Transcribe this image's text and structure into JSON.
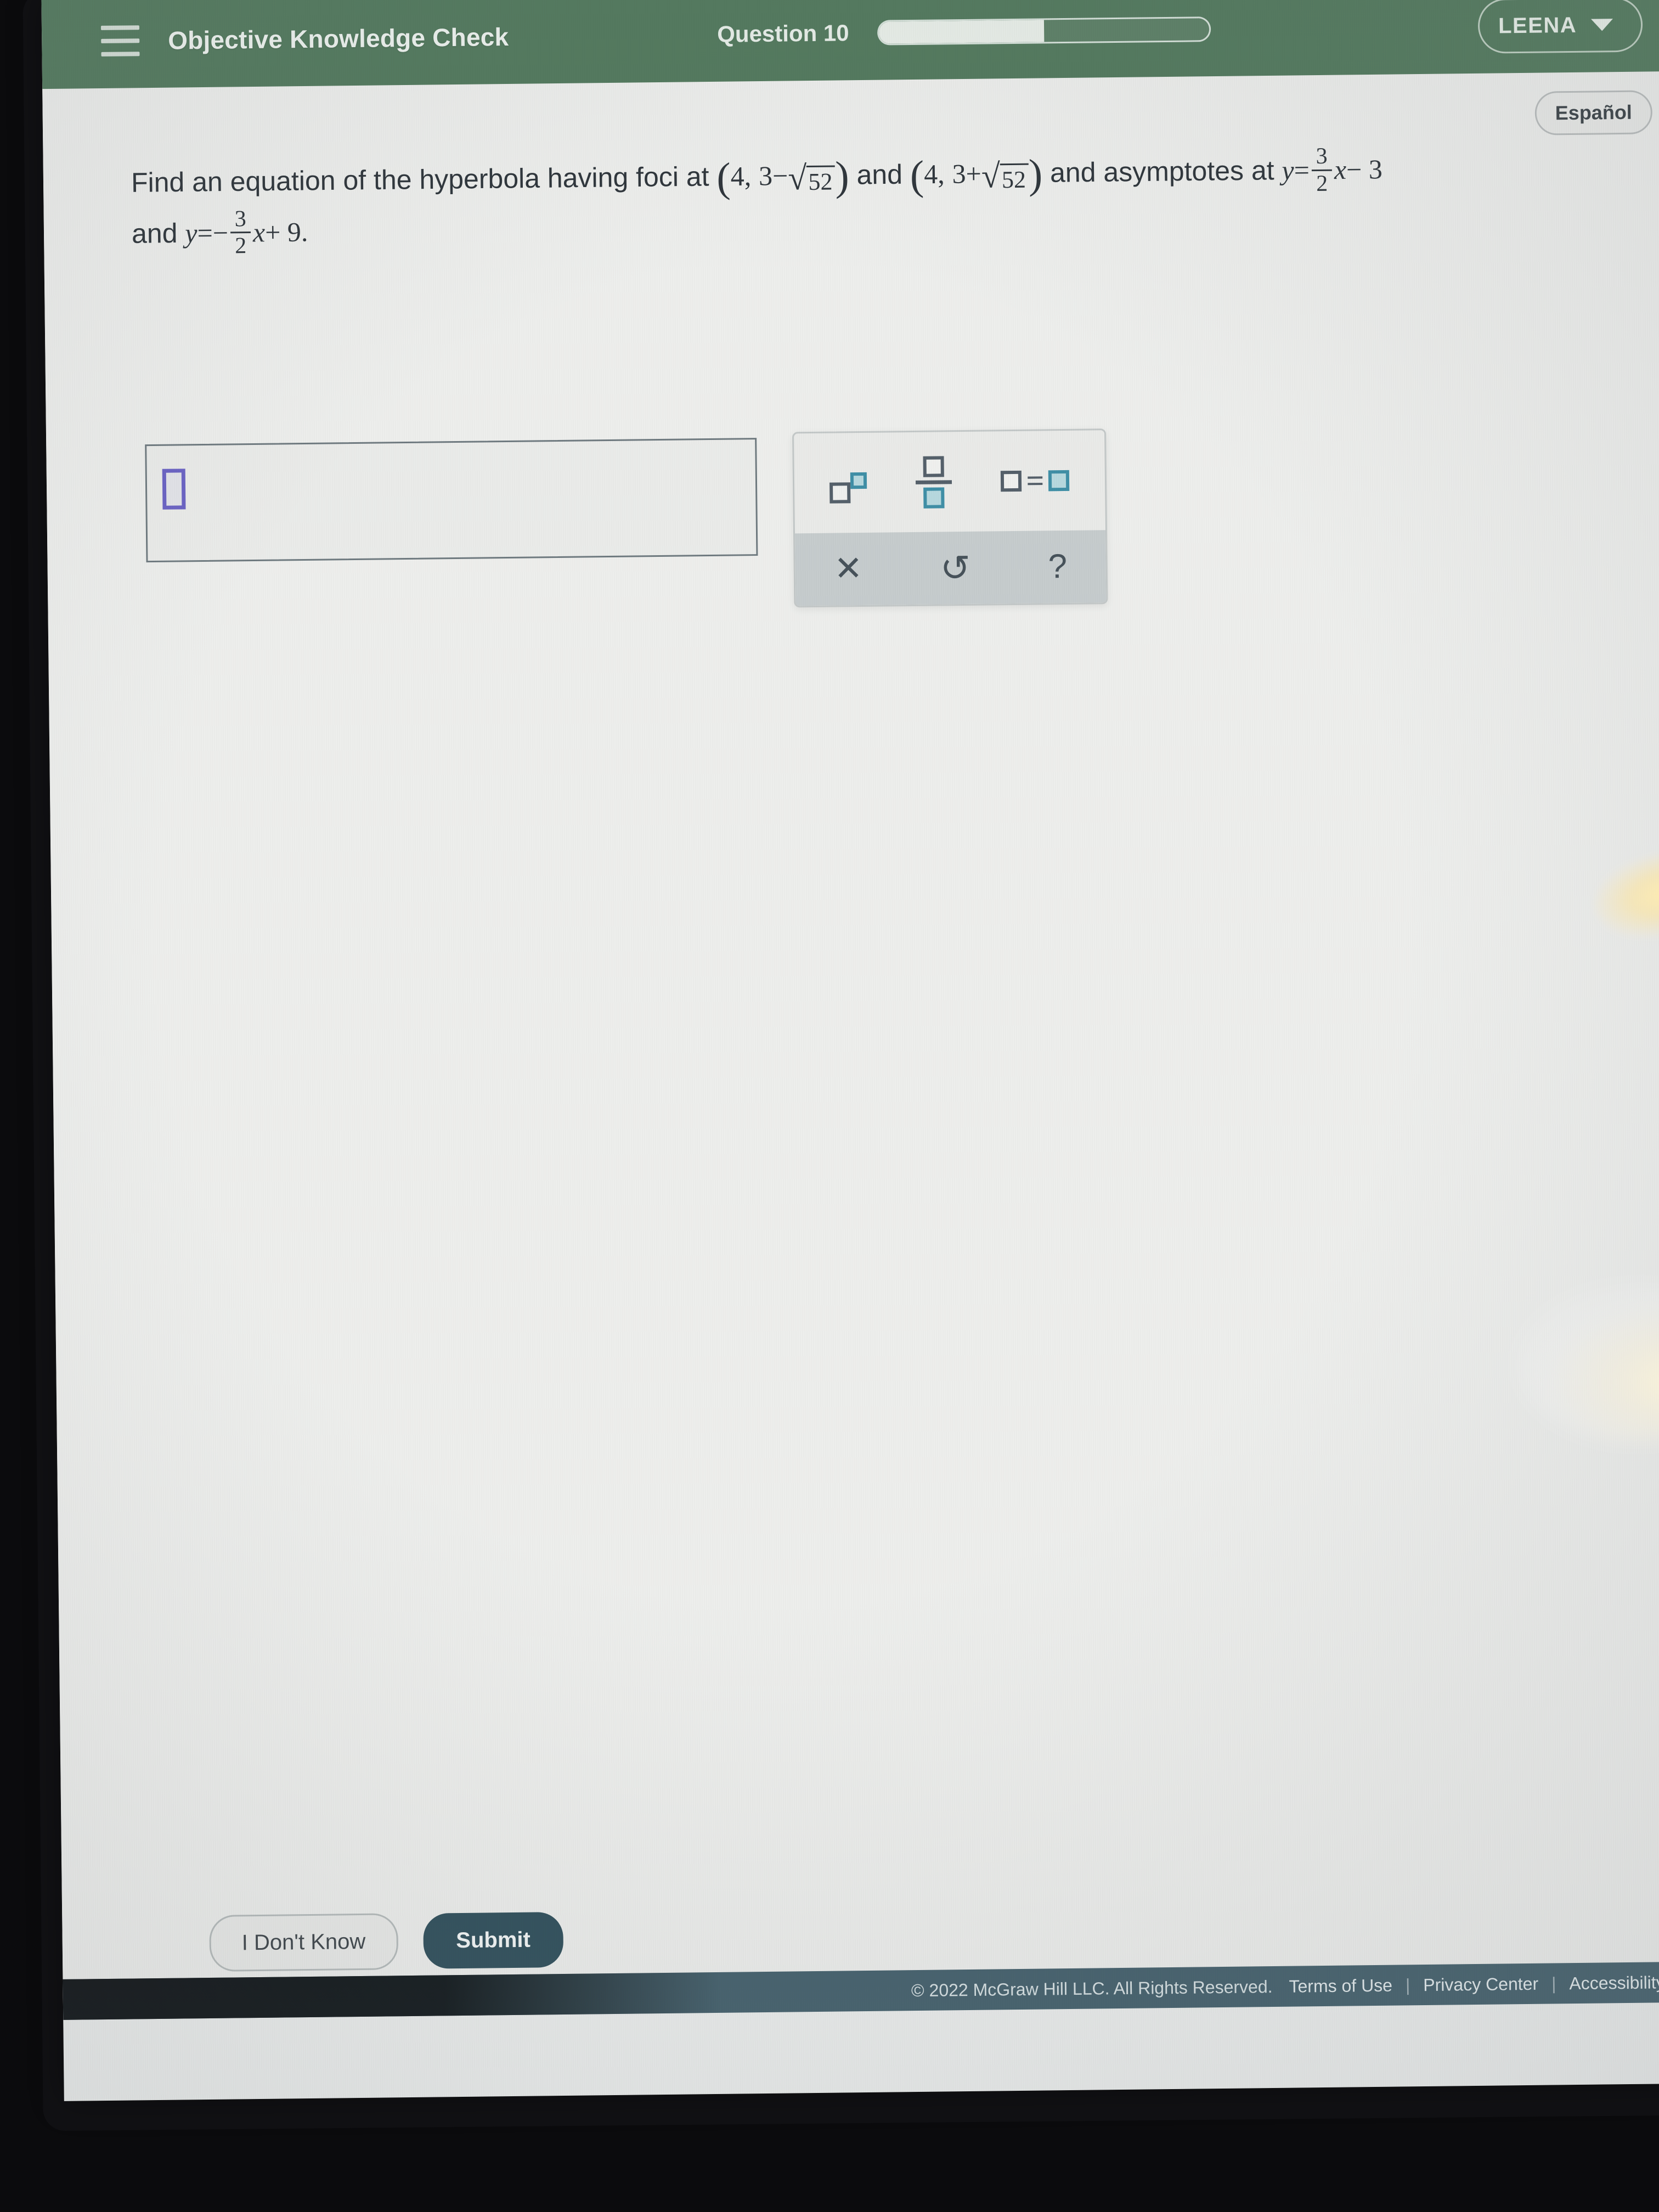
{
  "header": {
    "menu_icon": "hamburger-icon",
    "title": "Objective Knowledge Check",
    "question_label": "Question 10",
    "progress_percent": 50,
    "user_name": "LEENA",
    "chevron_icon": "chevron-down-icon"
  },
  "page": {
    "espanol_label": "Español"
  },
  "question": {
    "lead": "Find an equation of the hyperbola having foci at",
    "focus1": {
      "x": "4",
      "comma": ",",
      "y_start": "3",
      "op": "−",
      "sqrt_symbol": "√",
      "radicand": "52"
    },
    "conj": "and",
    "focus2": {
      "x": "4",
      "comma": ",",
      "y_start": "3",
      "op": "+",
      "sqrt_symbol": "√",
      "radicand": "52"
    },
    "mid": "and asymptotes at",
    "asymptote1": {
      "y": "y",
      "eq": "=",
      "num": "3",
      "den": "2",
      "var": "x",
      "tail": "− 3"
    },
    "and_word": "and",
    "asymptote2": {
      "y": "y",
      "eq": "=",
      "sign": "−",
      "num": "3",
      "den": "2",
      "var": "x",
      "tail": "+ 9."
    }
  },
  "answer": {
    "placeholder_box": "□",
    "value": ""
  },
  "math_palette": {
    "buttons": [
      {
        "name": "exponent-button",
        "label": "□^□"
      },
      {
        "name": "fraction-button",
        "label": "□/□"
      },
      {
        "name": "equals-button",
        "label": "□=□"
      }
    ],
    "equals_sign": "=",
    "clear_glyph": "✕",
    "undo_glyph": "↺",
    "help_glyph": "?"
  },
  "actions": {
    "i_dont_know_label": "I Don't Know",
    "submit_label": "Submit"
  },
  "footer": {
    "copyright": "© 2022 McGraw Hill LLC. All Rights Reserved.",
    "links": [
      "Terms of Use",
      "Privacy Center",
      "Accessibility"
    ],
    "separator": "|"
  },
  "colors": {
    "header_green": "#52795d",
    "submit_navy": "#2f4f5b",
    "footer_slate": "#44606c",
    "caret_purple": "#6b63c4",
    "palette_teal": "#3f8fa6"
  }
}
